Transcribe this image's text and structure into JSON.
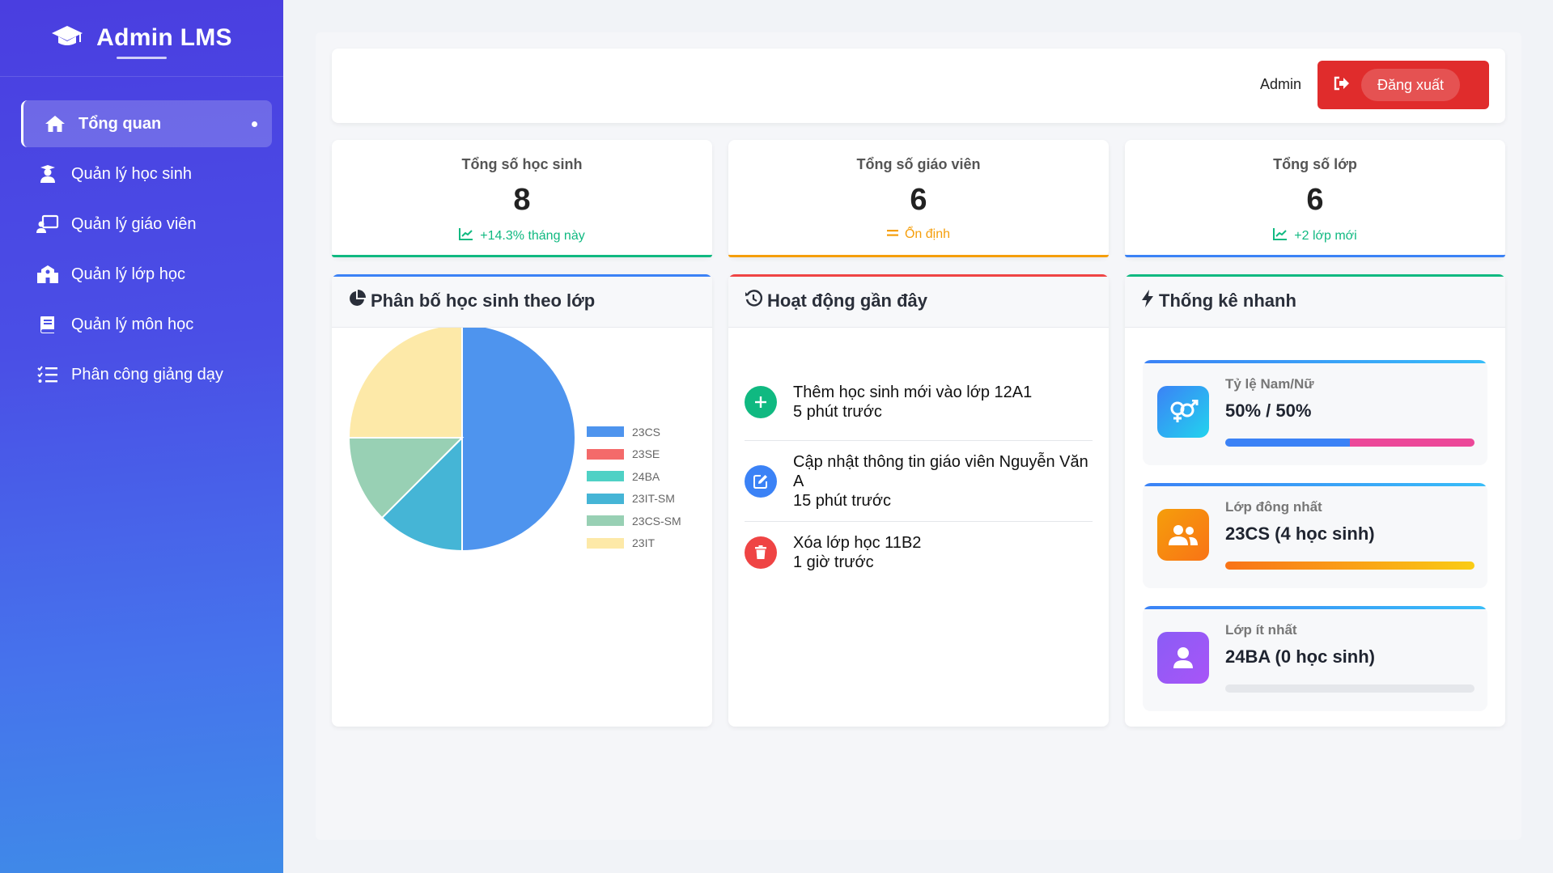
{
  "sidebar": {
    "brand": "Admin LMS",
    "items": [
      {
        "label": "Tổng quan",
        "icon": "home-icon"
      },
      {
        "label": "Quản lý học sinh",
        "icon": "student-icon"
      },
      {
        "label": "Quản lý giáo viên",
        "icon": "teacher-icon"
      },
      {
        "label": "Quản lý lớp học",
        "icon": "school-icon"
      },
      {
        "label": "Quản lý môn học",
        "icon": "book-icon"
      },
      {
        "label": "Phân công giảng dạy",
        "icon": "task-list-icon"
      }
    ]
  },
  "header": {
    "user": "Admin",
    "logout_label": "Đăng xuất"
  },
  "stats": [
    {
      "label": "Tổng số học sinh",
      "value": "8",
      "trend": "+14.3% tháng này",
      "color": "#10b981"
    },
    {
      "label": "Tổng số giáo viên",
      "value": "6",
      "trend": "Ổn định",
      "color": "#f59e0b"
    },
    {
      "label": "Tổng số lớp",
      "value": "6",
      "trend": "+2 lớp mới",
      "color": "#10b981"
    }
  ],
  "panels": {
    "distribution_title": "Phân bố học sinh theo lớp",
    "activity_title": "Hoạt động gần đây",
    "quick_title": "Thống kê nhanh"
  },
  "chart_data": {
    "type": "pie",
    "title": "Phân bố học sinh theo lớp",
    "categories": [
      "23CS",
      "23SE",
      "24BA",
      "23IT-SM",
      "23CS-SM",
      "23IT"
    ],
    "values": [
      4,
      0,
      0,
      1,
      1,
      2
    ],
    "colors": [
      "#4e94ee",
      "#f46a6a",
      "#4fd1c5",
      "#45b5d6",
      "#98d0b4",
      "#fde9a8"
    ],
    "legend_position": "right"
  },
  "activities": [
    {
      "line1": "Thêm học sinh mới vào lớp 12A1",
      "line2": "5 phút trước",
      "icon": "plus-icon",
      "color": "#10b981"
    },
    {
      "line1": "Cập nhật thông tin giáo viên Nguyễn Văn A",
      "line2": "15 phút trước",
      "icon": "edit-icon",
      "color": "#3b82f6"
    },
    {
      "line1": "Xóa lớp học 11B2",
      "line2": "1 giờ trước",
      "icon": "trash-icon",
      "color": "#ef4444"
    }
  ],
  "quick_stats": [
    {
      "label": "Tỷ lệ Nam/Nữ",
      "value": "50% / 50%",
      "icon": "gender-icon",
      "progress": 0.5
    },
    {
      "label": "Lớp đông nhất",
      "value": "23CS (4 học sinh)",
      "icon": "users-icon",
      "progress": 1.0
    },
    {
      "label": "Lớp ít nhất",
      "value": "24BA (0 học sinh)",
      "icon": "user-icon",
      "progress": 0.0
    }
  ]
}
